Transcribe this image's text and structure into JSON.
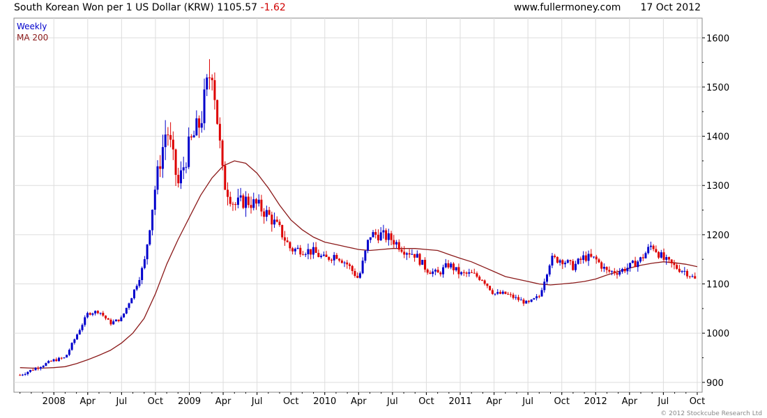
{
  "header": {
    "title": "South Korean Won per 1 US Dollar (KRW)",
    "last_value": "1105.57",
    "change": "-1.62",
    "website": "www.fullermoney.com",
    "date": "17 Oct 2012"
  },
  "legend": {
    "weekly": "Weekly",
    "ma": "MA 200"
  },
  "credit": "© 2012 Stockcube Research Ltd",
  "colors": {
    "up": "#0000cc",
    "down": "#dd0000",
    "ma": "#8b1a1a",
    "grid": "#dddddd",
    "chg": "#d00000"
  },
  "chart_data": {
    "type": "line",
    "subtype": "candlestick",
    "ylim": [
      880,
      1640
    ],
    "y_ticks": [
      "900",
      "1000",
      "1100",
      "1200",
      "1300",
      "1400",
      "1500",
      "1600"
    ],
    "x_ticks": [
      "2008",
      "Apr",
      "Jul",
      "Oct",
      "2009",
      "Apr",
      "Jul",
      "Oct",
      "2010",
      "Apr",
      "Jul",
      "Oct",
      "2011",
      "Apr",
      "Jul",
      "Oct",
      "2012",
      "Apr",
      "Jul",
      "Oct"
    ],
    "series": [
      {
        "name": "Weekly",
        "x": [
          "2007-10",
          "2007-11",
          "2007-12",
          "2008-01",
          "2008-02",
          "2008-03",
          "2008-04",
          "2008-05",
          "2008-06",
          "2008-07",
          "2008-08",
          "2008-09",
          "2008-10",
          "2008-11",
          "2008-12",
          "2009-01",
          "2009-02",
          "2009-03",
          "2009-04",
          "2009-05",
          "2009-06",
          "2009-07",
          "2009-08",
          "2009-09",
          "2009-10",
          "2009-11",
          "2009-12",
          "2010-01",
          "2010-02",
          "2010-03",
          "2010-04",
          "2010-05",
          "2010-06",
          "2010-07",
          "2010-08",
          "2010-09",
          "2010-10",
          "2010-11",
          "2010-12",
          "2011-01",
          "2011-02",
          "2011-03",
          "2011-04",
          "2011-05",
          "2011-06",
          "2011-07",
          "2011-08",
          "2011-09",
          "2011-10",
          "2011-11",
          "2011-12",
          "2012-01",
          "2012-02",
          "2012-03",
          "2012-04",
          "2012-05",
          "2012-06",
          "2012-07",
          "2012-08",
          "2012-09",
          "2012-10"
        ],
        "values": [
          915,
          925,
          935,
          945,
          950,
          995,
          1040,
          1045,
          1020,
          1030,
          1080,
          1140,
          1300,
          1420,
          1300,
          1380,
          1430,
          1550,
          1310,
          1260,
          1270,
          1260,
          1240,
          1210,
          1170,
          1170,
          1165,
          1150,
          1160,
          1140,
          1110,
          1200,
          1200,
          1190,
          1170,
          1160,
          1130,
          1120,
          1140,
          1120,
          1120,
          1110,
          1080,
          1080,
          1070,
          1060,
          1075,
          1150,
          1150,
          1135,
          1155,
          1150,
          1125,
          1125,
          1135,
          1150,
          1180,
          1150,
          1135,
          1125,
          1105
        ]
      },
      {
        "name": "MA 200",
        "x": [
          "2007-10",
          "2007-11",
          "2007-12",
          "2008-01",
          "2008-02",
          "2008-03",
          "2008-04",
          "2008-05",
          "2008-06",
          "2008-07",
          "2008-08",
          "2008-09",
          "2008-10",
          "2008-11",
          "2008-12",
          "2009-01",
          "2009-02",
          "2009-03",
          "2009-04",
          "2009-05",
          "2009-06",
          "2009-07",
          "2009-08",
          "2009-09",
          "2009-10",
          "2009-11",
          "2009-12",
          "2010-01",
          "2010-02",
          "2010-03",
          "2010-04",
          "2010-05",
          "2010-06",
          "2010-07",
          "2010-08",
          "2010-09",
          "2010-10",
          "2010-11",
          "2010-12",
          "2011-01",
          "2011-02",
          "2011-03",
          "2011-04",
          "2011-05",
          "2011-06",
          "2011-07",
          "2011-08",
          "2011-09",
          "2011-10",
          "2011-11",
          "2011-12",
          "2012-01",
          "2012-02",
          "2012-03",
          "2012-04",
          "2012-05",
          "2012-06",
          "2012-07",
          "2012-08",
          "2012-09",
          "2012-10"
        ],
        "values": [
          930,
          929,
          929,
          930,
          932,
          938,
          946,
          955,
          965,
          980,
          1000,
          1030,
          1080,
          1140,
          1190,
          1235,
          1280,
          1315,
          1340,
          1350,
          1345,
          1325,
          1295,
          1260,
          1230,
          1210,
          1195,
          1185,
          1180,
          1175,
          1170,
          1168,
          1170,
          1172,
          1172,
          1172,
          1170,
          1168,
          1160,
          1152,
          1145,
          1135,
          1125,
          1115,
          1110,
          1105,
          1100,
          1098,
          1100,
          1102,
          1105,
          1110,
          1118,
          1125,
          1132,
          1138,
          1142,
          1145,
          1143,
          1140,
          1135
        ]
      }
    ]
  }
}
